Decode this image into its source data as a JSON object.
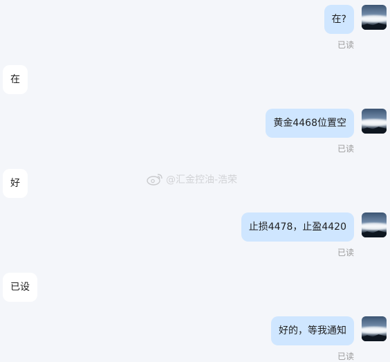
{
  "messages": [
    {
      "side": "me",
      "text": "在?",
      "status": "已读"
    },
    {
      "side": "other",
      "text": "在"
    },
    {
      "side": "me",
      "text": "黄金4468位置空",
      "status": "已读"
    },
    {
      "side": "other",
      "text": "好"
    },
    {
      "side": "me",
      "text": "止损4478，止盈4420",
      "status": "已读"
    },
    {
      "side": "other",
      "text": "已设"
    },
    {
      "side": "me",
      "text": "好的，等我通知",
      "status": "已读"
    }
  ],
  "watermark": {
    "icon": "weibo-icon",
    "text": "@汇金控油-浩荣"
  }
}
